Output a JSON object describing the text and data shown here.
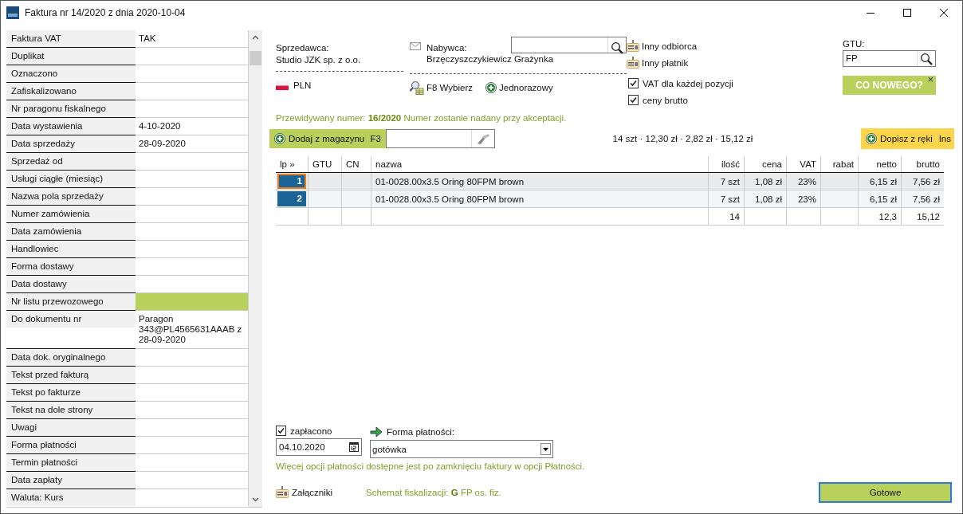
{
  "window": {
    "title": "Faktura nr 14/2020 z dnia 2020-10-04"
  },
  "properties": [
    {
      "label": "Faktura VAT",
      "value": "TAK",
      "highlighted": false
    },
    {
      "label": "Duplikat",
      "highlighted": false
    },
    {
      "label": "Oznaczono",
      "highlighted": false
    },
    {
      "label": "Zafiskalizowano",
      "highlighted": false
    },
    {
      "label": "Nr paragonu fiskalnego",
      "highlighted": false
    },
    {
      "label": "Data wystawienia",
      "value": "4-10-2020",
      "highlighted": false
    },
    {
      "label": "Data sprzedaży",
      "value": "28-09-2020",
      "highlighted": false
    },
    {
      "label": "Sprzedaż od",
      "highlighted": false
    },
    {
      "label": "Usługi ciągłe (miesiąc)",
      "highlighted": false
    },
    {
      "label": "Nazwa pola sprzedaży",
      "highlighted": false
    },
    {
      "label": "Numer zamówienia",
      "highlighted": false
    },
    {
      "label": "Data zamówienia",
      "highlighted": false
    },
    {
      "label": "Handlowiec",
      "highlighted": false
    },
    {
      "label": "Forma dostawy",
      "highlighted": false
    },
    {
      "label": "Data dostawy",
      "highlighted": false
    },
    {
      "label": "Nr listu przewozowego",
      "highlighted": true
    },
    {
      "label": "Do dokumentu nr",
      "value": "Paragon 343@PL4565631AAAB z 28-09-2020",
      "highlighted": false
    },
    {
      "label": "Data dok. oryginalnego",
      "highlighted": false
    },
    {
      "label": "Tekst przed fakturą",
      "highlighted": false
    },
    {
      "label": "Tekst po fakturze",
      "highlighted": false
    },
    {
      "label": "Tekst na dole strony",
      "highlighted": false
    },
    {
      "label": "Uwagi",
      "highlighted": false
    },
    {
      "label": "Forma płatności",
      "highlighted": false
    },
    {
      "label": "Termin płatności",
      "highlighted": false
    },
    {
      "label": "Data zapłaty",
      "highlighted": false
    },
    {
      "label": "Waluta: Kurs",
      "highlighted": false
    }
  ],
  "seller": {
    "label": "Sprzedawca:",
    "name": "Studio JZK sp. z o.o."
  },
  "buyer": {
    "label": "Nabywca:",
    "name": "Brzęczyszczykiewicz Grażynka"
  },
  "currency": "PLN",
  "buyer_actions": [
    {
      "label": "F8 Wybierz",
      "kind": "pick"
    },
    {
      "label": "Jednorazowy",
      "kind": "add"
    }
  ],
  "party_links": [
    "Inny odbiorca",
    "Inny płatnik"
  ],
  "options": [
    {
      "label": "VAT dla każdej pozycji",
      "checked": true
    },
    {
      "label": "ceny brutto",
      "checked": true
    }
  ],
  "gtu": {
    "label": "GTU:",
    "value": "FP"
  },
  "whats_new": {
    "label": "CO NOWEGO?",
    "close": "×"
  },
  "predicted_number": "Przewidywany numer: **16/2020** Numer zostanie nadany przy akceptacji.",
  "add_from_stock": {
    "label": "Dodaj z magazynu",
    "shortcut": "F3"
  },
  "summary": "14 szt · 12,30 zł · 2,82 zł · 15,12 zł",
  "add_manual": {
    "label": "Dopisz z ręki",
    "shortcut": "Ins"
  },
  "table": {
    "columns": [
      "lp »",
      "GTU",
      "CN",
      "nazwa",
      "ilość",
      "cena",
      "VAT",
      "rabat",
      "netto",
      "brutto"
    ],
    "rows": [
      {
        "kind": "item",
        "selected": true,
        "lp": "1",
        "name": "01-0028.00x3.5 Oring 80FPM brown",
        "qty": "7 szt",
        "price": "1,08 zł",
        "vat": "23%",
        "net": "6,15 zł",
        "gross": "7,56 zł"
      },
      {
        "kind": "item",
        "selected": false,
        "lp": "2",
        "name": "01-0028.00x3.5 Oring 80FPM brown",
        "qty": "7 szt",
        "price": "1,08 zł",
        "vat": "23%",
        "net": "6,15 zł",
        "gross": "7,56 zł"
      },
      {
        "kind": "total",
        "selected": false,
        "qty": "14",
        "net": "12,3",
        "gross": "15,12"
      }
    ]
  },
  "payment": {
    "paid": {
      "label": "zapłacono",
      "checked": true
    },
    "date": "04.10.2020",
    "method_label": "Forma płatności:",
    "method": "gotówka",
    "note": "Więcej opcji płatności dostępne jest po zamknięciu faktury w opcji Płatności."
  },
  "attachments": "Załączniki",
  "fiscal_scheme": "Schemat fiskalizacji: **G** FP os. fiz.",
  "done_button": "Gotowe"
}
